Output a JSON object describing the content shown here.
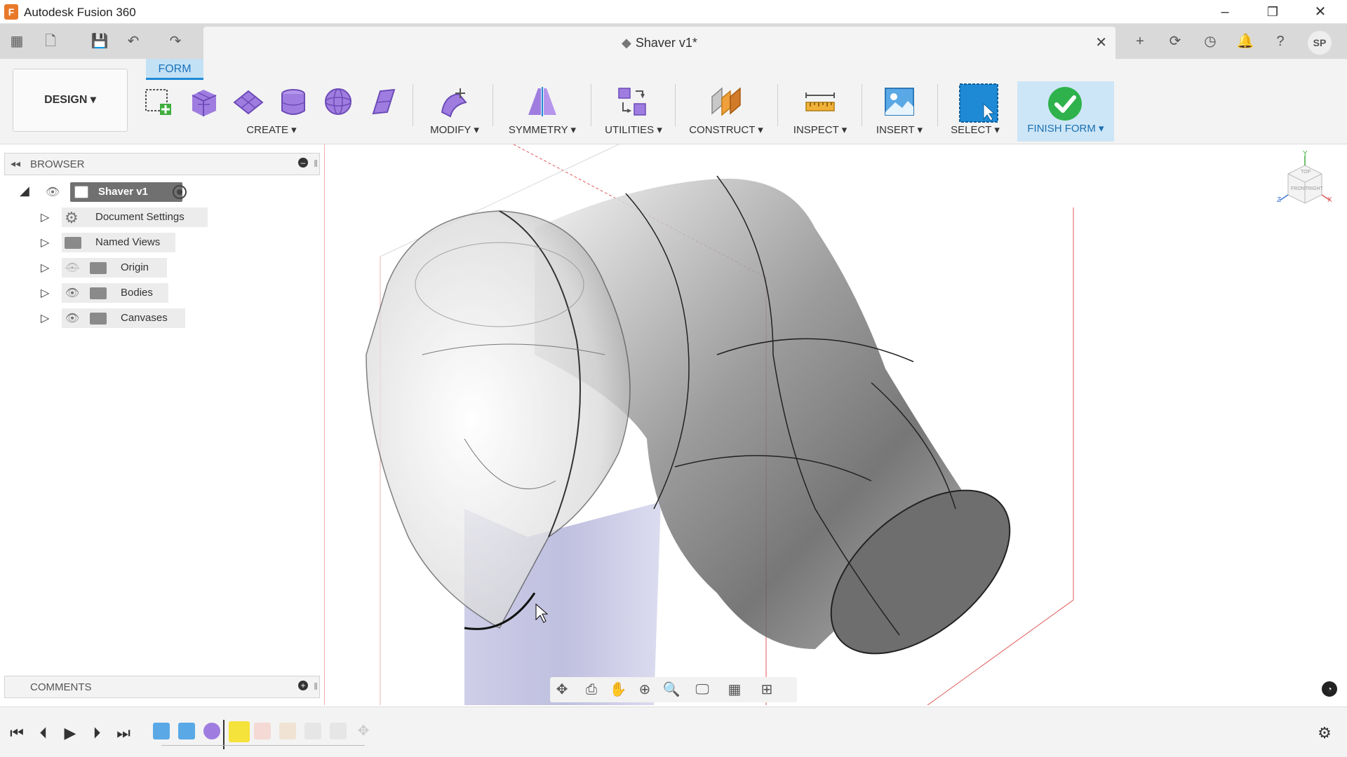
{
  "window": {
    "app_title": "Autodesk Fusion 360",
    "minimize": "–",
    "restore": "❐",
    "close": "✕"
  },
  "document": {
    "tab_title": "Shaver v1*",
    "close": "✕"
  },
  "quick_access": {
    "user_initials": "SP"
  },
  "toolbar": {
    "active_tab": "FORM",
    "workspace": "DESIGN ▾",
    "groups": {
      "create": "CREATE ▾",
      "modify": "MODIFY ▾",
      "symmetry": "SYMMETRY ▾",
      "utilities": "UTILITIES ▾",
      "construct": "CONSTRUCT ▾",
      "inspect": "INSPECT ▾",
      "insert": "INSERT ▾",
      "select": "SELECT ▾",
      "finish_form": "FINISH FORM ▾"
    }
  },
  "browser": {
    "title": "BROWSER",
    "root": "Shaver v1",
    "items": [
      {
        "label": "Document Settings",
        "icon": "gear-icon"
      },
      {
        "label": "Named Views",
        "icon": "folder-icon"
      },
      {
        "label": "Origin",
        "icon": "folder-icon",
        "hidden": true
      },
      {
        "label": "Bodies",
        "icon": "folder-icon"
      },
      {
        "label": "Canvases",
        "icon": "folder-icon"
      }
    ]
  },
  "comments": {
    "title": "COMMENTS"
  },
  "viewcube": {
    "axis_x": "X",
    "axis_y": "Y",
    "axis_z": "Z",
    "face_top": "TOP",
    "face_front": "FRONT",
    "face_right": "RIGHT"
  },
  "colors": {
    "form_accent": "#8f6fd6",
    "select_blue": "#1e8ad6",
    "finish_green": "#2fb24c",
    "sketch_red": "#e05a5a"
  }
}
